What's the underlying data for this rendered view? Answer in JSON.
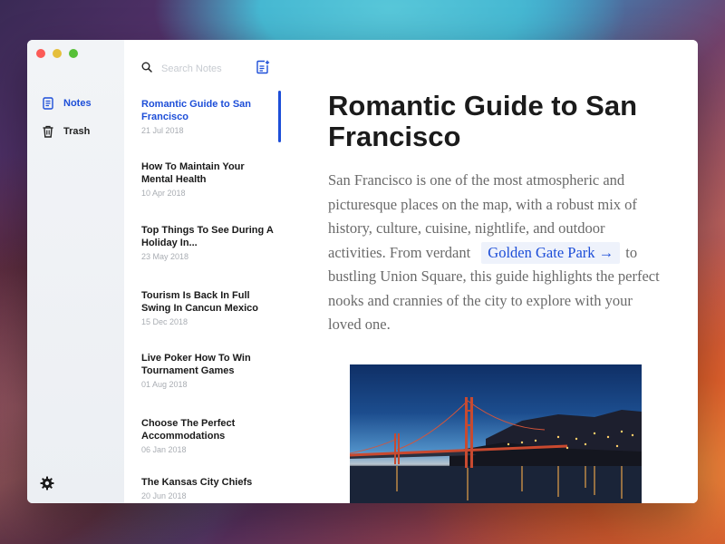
{
  "window": {
    "traffic_lights": {
      "close": "#fc5b57",
      "minimize": "#e5bf3c",
      "zoom": "#57c038"
    }
  },
  "sidebar": {
    "items": [
      {
        "label": "Notes",
        "icon": "notes-icon",
        "active": true
      },
      {
        "label": "Trash",
        "icon": "trash-icon",
        "active": false
      }
    ],
    "settings_icon": "gear-icon"
  },
  "notes_list": {
    "search_placeholder": "Search Notes",
    "new_note_icon": "new-note-icon",
    "notes": [
      {
        "title": "Romantic Guide to San Francisco",
        "date": "21 Jul 2018",
        "active": true
      },
      {
        "title": "How To Maintain Your Mental Health",
        "date": "10 Apr 2018",
        "active": false
      },
      {
        "title": "Top Things To See During A Holiday In...",
        "date": "23 May 2018",
        "active": false
      },
      {
        "title": "Tourism Is Back In Full Swing In Cancun Mexico",
        "date": "15 Dec 2018",
        "active": false
      },
      {
        "title": "Live Poker How To Win Tournament Games",
        "date": "01 Aug 2018",
        "active": false
      },
      {
        "title": "Choose The Perfect Accommodations",
        "date": "06 Jan 2018",
        "active": false
      },
      {
        "title": "The Kansas City Chiefs",
        "date": "20 Jun 2018",
        "active": false
      }
    ]
  },
  "document": {
    "title": "Romantic Guide to San Francisco",
    "body_before_link": "San Francisco is one of the most atmospheric and picturesque places on the map, with a robust mix of history, culture, cuisine, nightlife, and outdoor activities. From verdant",
    "link_text": "Golden Gate Park →",
    "body_after_link": "to bustling Union Square, this guide highlights the perfect nooks and crannies of the city to explore with your loved one."
  },
  "accent_color": "#1d4ed8"
}
